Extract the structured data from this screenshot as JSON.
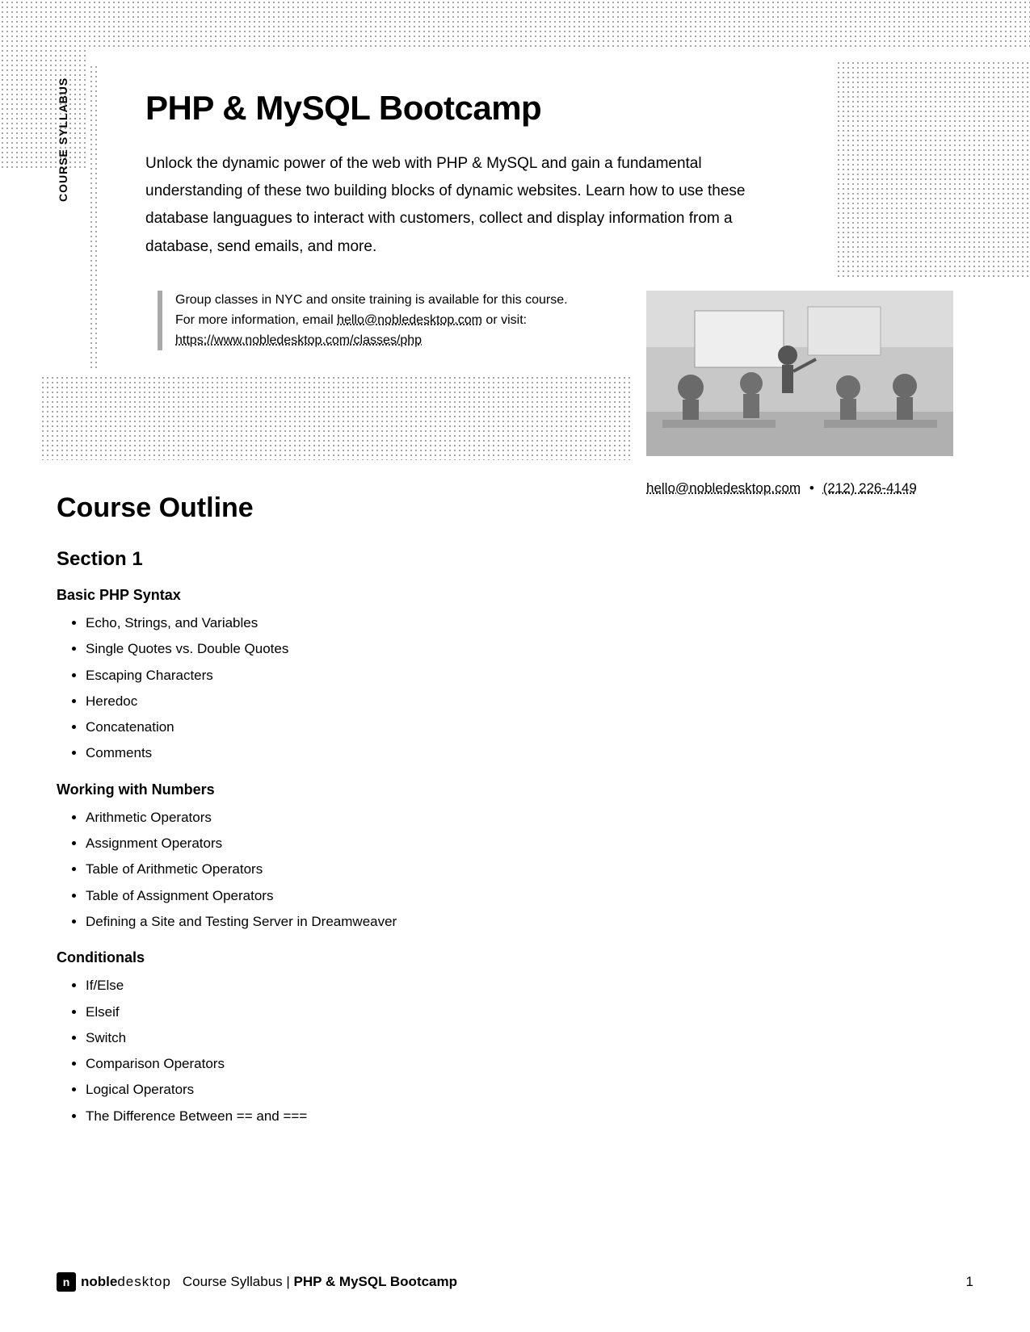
{
  "sidebar_label": "COURSE SYLLABUS",
  "title": "PHP & MySQL Bootcamp",
  "intro": "Unlock the dynamic power of the web with PHP & MySQL and gain a fundamental understanding of these two building blocks of dynamic websites. Learn how to use these database languagues to interact with customers, collect and display information from a database, send emails, and more.",
  "info": {
    "line1": "Group classes in NYC and onsite training is available for this course.",
    "line2_prefix": "For more information, email ",
    "email": "hello@nobledesktop.com",
    "line2_suffix": " or visit:",
    "url": "https://www.nobledesktop.com/classes/php"
  },
  "contact": {
    "email": "hello@nobledesktop.com",
    "separator": "•",
    "phone": "(212) 226-4149"
  },
  "outline": {
    "heading": "Course Outline",
    "section_label": "Section 1",
    "topics": [
      {
        "title": "Basic PHP Syntax",
        "items": [
          "Echo, Strings, and Variables",
          "Single Quotes vs. Double Quotes",
          "Escaping Characters",
          "Heredoc",
          "Concatenation",
          "Comments"
        ]
      },
      {
        "title": "Working with Numbers",
        "items": [
          "Arithmetic Operators",
          "Assignment Operators",
          "Table of Arithmetic Operators",
          "Table of Assignment Operators",
          "Defining a Site and Testing Server in Dreamweaver"
        ]
      },
      {
        "title": "Conditionals",
        "items": [
          "If/Else",
          "Elseif",
          "Switch",
          "Comparison Operators",
          "Logical Operators",
          "The Difference Between == and ==="
        ]
      }
    ]
  },
  "footer": {
    "brand_bold": "noble",
    "brand_thin": "desktop",
    "label_prefix": "Course Syllabus | ",
    "course_name": "PHP & MySQL Bootcamp",
    "page_number": "1"
  }
}
